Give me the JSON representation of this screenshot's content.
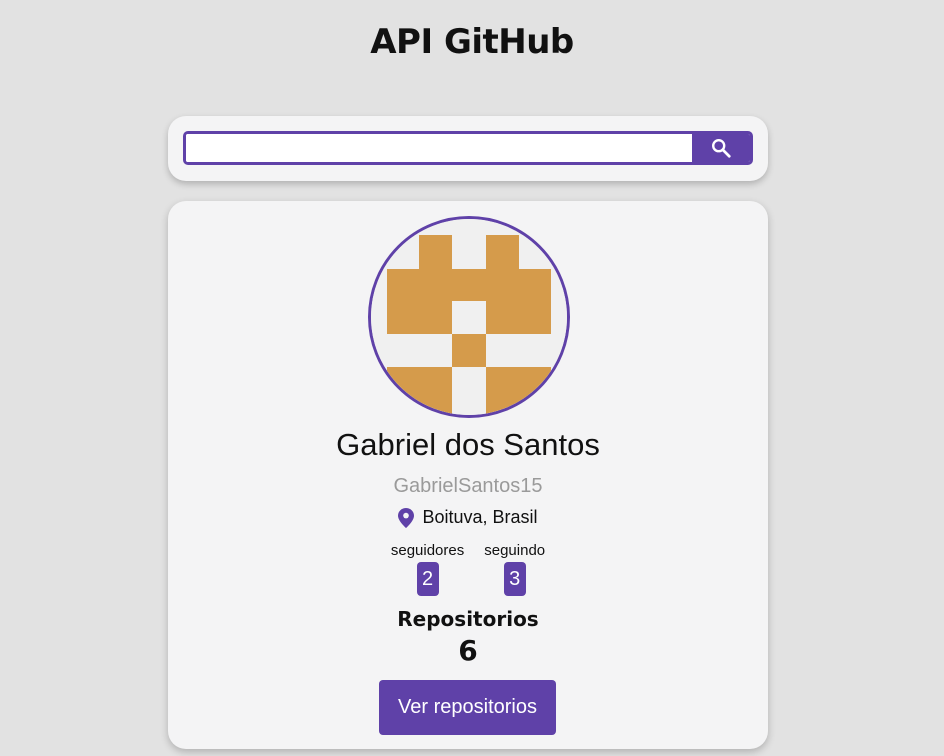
{
  "header": {
    "title": "API GitHub"
  },
  "search": {
    "value": "",
    "icon": "search-icon",
    "accent": "#5f41a8"
  },
  "profile": {
    "avatar_color": "#d59b4b",
    "name": "Gabriel dos Santos",
    "username": "GabrielSantos15",
    "location_icon": "location-pin-icon",
    "location": "Boituva, Brasil",
    "followers_label": "seguidores",
    "followers_count": "2",
    "following_label": "seguindo",
    "following_count": "3",
    "repos_label": "Repositorios",
    "repos_count": "6",
    "repos_button": "Ver repositorios"
  }
}
